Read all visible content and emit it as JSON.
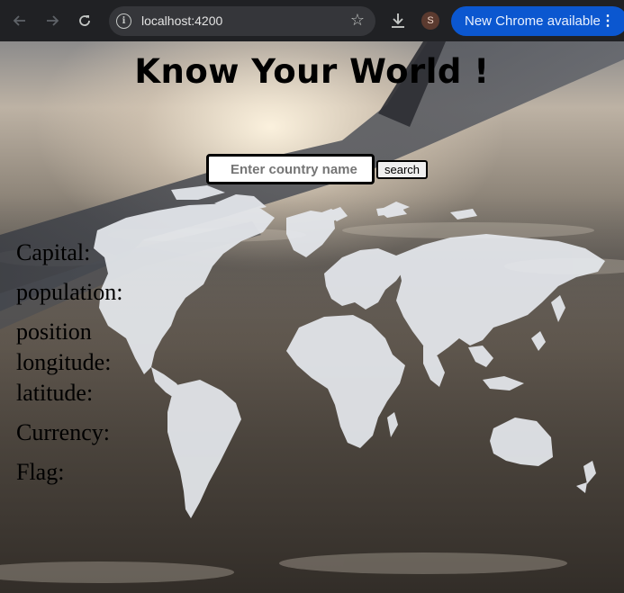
{
  "browser": {
    "back_icon": "arrow-left-icon",
    "forward_icon": "arrow-right-icon",
    "reload_icon": "reload-icon",
    "url": "localhost:4200",
    "profile_initial": "S",
    "update_label": "New Chrome available",
    "menu_icon": "more-vertical-icon"
  },
  "page": {
    "title": "Know Your World !",
    "search": {
      "placeholder": "Enter country name",
      "value": "",
      "button_label": "search"
    },
    "fields": {
      "capital": "Capital:",
      "population": "population:",
      "position": "position",
      "longitude": "longitude:",
      "latitude": "latitude:",
      "currency": "Currency:",
      "flag": "Flag:"
    }
  },
  "colors": {
    "chrome_bg": "#202124",
    "omnibox_bg": "#35363a",
    "update_pill": "#0b57d0",
    "map_land": "#e6e9ee"
  }
}
